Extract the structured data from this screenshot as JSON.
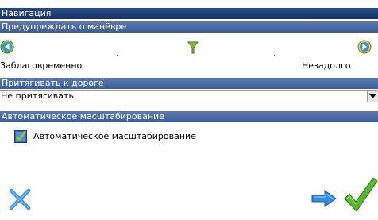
{
  "window": {
    "title": "Навигация"
  },
  "maneuver_warning": {
    "header": "Предупреждать о манёвре",
    "left_label": "Заблаговременно",
    "right_label": "Незадолго",
    "level": 0.5
  },
  "snap_to_road": {
    "header": "Притягивать к дороге",
    "selected": "Не притягивать"
  },
  "auto_zoom": {
    "header": "Автоматическое масштабирование",
    "checkbox_label": "Автоматическое масштабирование",
    "checked": true
  },
  "actions": {
    "cancel_icon": "cross-icon",
    "next_icon": "arrow-right-icon",
    "ok_icon": "checkmark-icon"
  },
  "colors": {
    "header_bar": "#4a6aa3",
    "title_bar": "#1f3d78",
    "cross": "#2a8be0",
    "check": "#55b82e",
    "arrow": "#2f8fe0"
  }
}
